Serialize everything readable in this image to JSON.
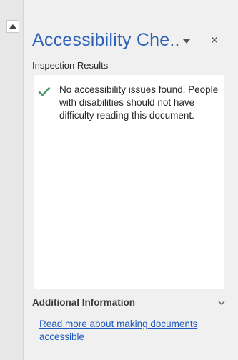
{
  "pane": {
    "title": "Accessibility Che..",
    "close_glyph": "×",
    "section_label": "Inspection Results",
    "result_message": "No accessibility issues found. People with disabilities should not have difficulty reading this document.",
    "additional_title": "Additional Information",
    "read_more_link": "Read more about making documents accessible"
  },
  "icons": {
    "scroll_up": "triangle-up-icon",
    "pane_menu": "triangle-down-icon",
    "close": "close-icon",
    "result": "checkmark-icon",
    "expand": "chevron-down-icon"
  },
  "colors": {
    "title_blue": "#2e62b8",
    "link_blue": "#1f5bbf",
    "check_green": "#4a9a62",
    "pane_bg": "#f0f0f0",
    "results_bg": "#ffffff"
  }
}
